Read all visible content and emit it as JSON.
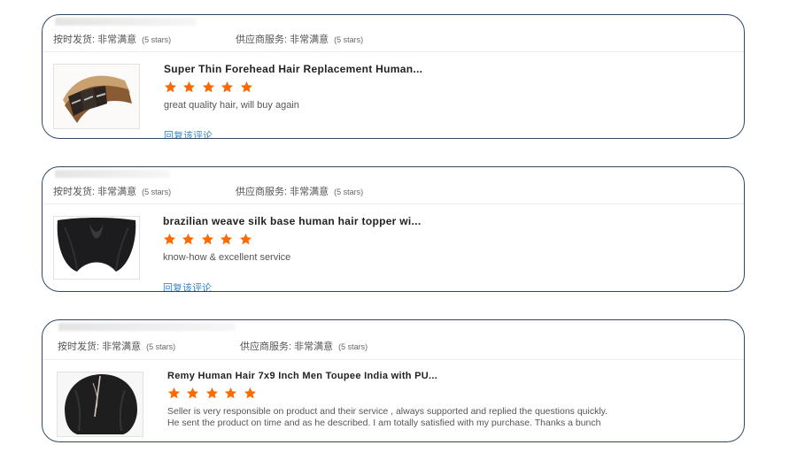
{
  "reviews": [
    {
      "delivery_label": "按时发货: 非常满意",
      "delivery_stars": "(5 stars)",
      "service_label": "供应商服务: 非常满意",
      "service_stars": "(5 stars)",
      "product_title": "Super Thin Forehead Hair Replacement Human...",
      "rating": 5,
      "review_text": "great quality hair, will buy again",
      "reply_link": "回复该评论"
    },
    {
      "delivery_label": "按时发货: 非常满意",
      "delivery_stars": "(5 stars)",
      "service_label": "供应商服务: 非常满意",
      "service_stars": "(5 stars)",
      "product_title": "brazilian weave silk base human hair topper wi...",
      "rating": 5,
      "review_text": "know-how & excellent service",
      "reply_link": "回复该评论"
    },
    {
      "delivery_label": "按时发货: 非常满意",
      "delivery_stars": "(5 stars)",
      "service_label": "供应商服务: 非常满意",
      "service_stars": "(5 stars)",
      "product_title": "Remy Human Hair 7x9 Inch Men Toupee India with PU...",
      "rating": 5,
      "review_text_line1": "Seller is very responsible on product and their service , always supported and replied the questions quickly.",
      "review_text_line2": "He sent the product on time and as he described.  I am totally satisfied with my purchase. Thanks a bunch"
    }
  ],
  "colors": {
    "star": "#ff6a00",
    "link": "#3a86c8",
    "card_border": "#2c4a66"
  },
  "icons": {
    "star": "star-icon"
  }
}
